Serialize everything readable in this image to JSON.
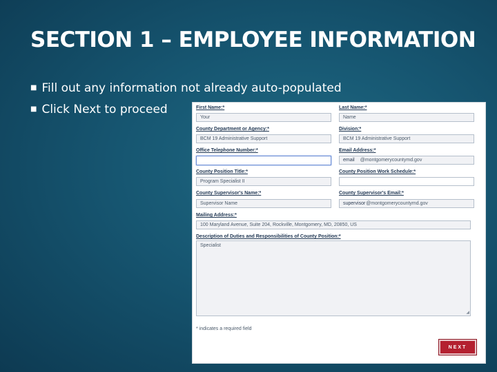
{
  "title": "SECTION 1 – EMPLOYEE INFORMATION",
  "bullets": [
    "Fill out any information not already auto-populated",
    "Click Next to proceed"
  ],
  "bullet_glyph": "■",
  "form": {
    "first_name": {
      "label": "First Name:*",
      "value": "Your"
    },
    "last_name": {
      "label": "Last Name:*",
      "value": "Name"
    },
    "county_department": {
      "label": "County Department or Agency:*",
      "value": "BCM 19 Administrative Support"
    },
    "division": {
      "label": "Division:*",
      "value": "BCM 19 Administrative Support"
    },
    "office_phone": {
      "label": "Office Telephone Number:*",
      "value": ""
    },
    "email": {
      "label": "Email Address:*",
      "prefix": "email",
      "value": "@montgomerycountymd.gov"
    },
    "county_position_title": {
      "label": "County Position Title:*",
      "value": "Program Specialist II"
    },
    "work_schedule": {
      "label": "County Position Work Schedule:*",
      "value": ""
    },
    "supervisor_name": {
      "label": "County Supervisor's Name:*",
      "value": "Supervisor Name"
    },
    "supervisor_email": {
      "label": "County Supervisor's Email:*",
      "prefix": "supervisor",
      "value": "@montgomerycountymd.gov"
    },
    "mailing_address": {
      "label": "Mailing Address:*",
      "value": "100 Maryland Avenue, Suite 204, Rockville, Montgomery, MD, 20850, US"
    },
    "duties": {
      "label": "Description of Duties and Responsibilities of County Position:*",
      "value": "Specialist"
    },
    "required_note": "* indicates a required field",
    "next_label": "NEXT"
  }
}
